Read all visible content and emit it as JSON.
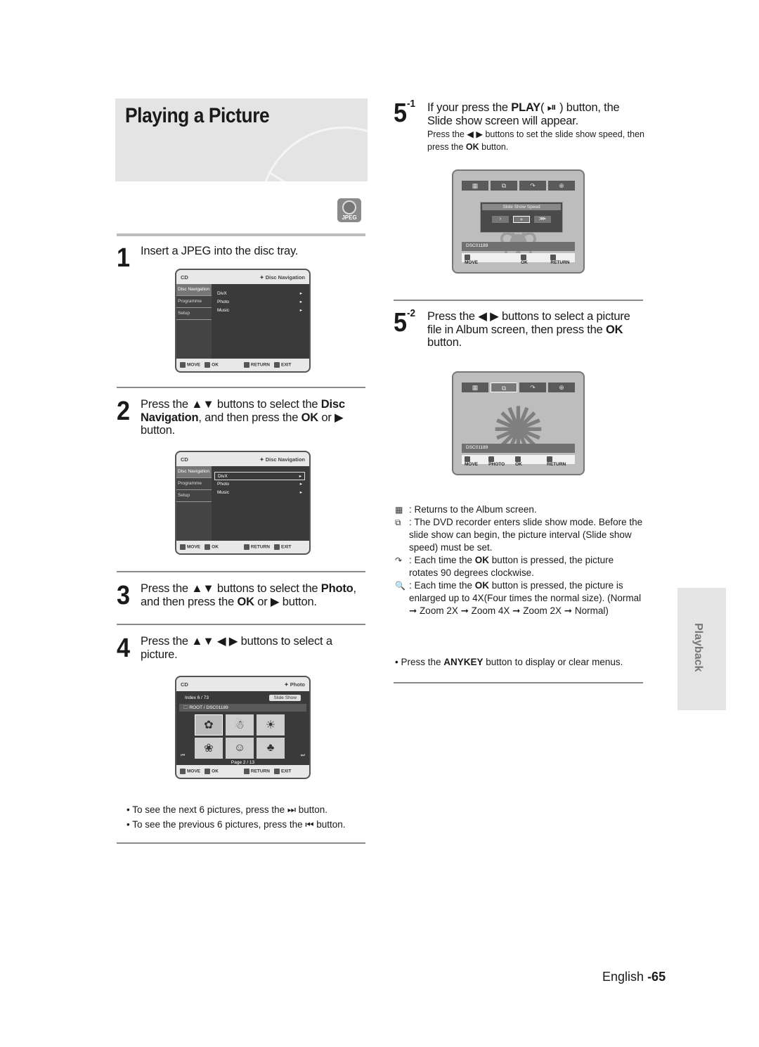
{
  "page": {
    "title": "Playing a Picture",
    "jpeg_badge": "JPEG",
    "side_tab": "Playback",
    "footer_lang": "English",
    "footer_page": "-65"
  },
  "steps": {
    "s1": {
      "num": "1",
      "text": "Insert a JPEG into the disc tray."
    },
    "s2": {
      "num": "2",
      "pre": "Press the ▲▼ buttons to select the ",
      "b1": "Disc Navigation",
      "mid": ", and then press the ",
      "b2": "OK",
      "post": " or ▶ button."
    },
    "s3": {
      "num": "3",
      "pre": "Press the ▲▼ buttons to select the ",
      "b1": "Photo",
      "mid": ", and then press the ",
      "b2": "OK",
      "post": " or ▶ button."
    },
    "s4": {
      "num": "4",
      "text": "Press the ▲▼ ◀ ▶ buttons to select a picture."
    },
    "s51": {
      "num": "5",
      "sup": "-1",
      "pre": "If your press the ",
      "b1": "PLAY",
      "post": "( ⏯ ) button, the Slide show screen will appear.",
      "sub_pre": "Press the ◀ ▶ buttons to set the slide show speed, then press the ",
      "sub_b": "OK",
      "sub_post": " button."
    },
    "s52": {
      "num": "5",
      "sup": "-2",
      "pre": "Press the ◀ ▶ buttons to select a picture file in Album screen, then press the ",
      "b1": "OK",
      "post": " button."
    }
  },
  "osd_menu": {
    "source": "CD",
    "title": "✦ Disc Navigation",
    "side": [
      "Disc Navigation",
      "Programme",
      "Setup"
    ],
    "items": [
      "DivX",
      "Photo",
      "Music"
    ],
    "keys": {
      "move": "MOVE",
      "ok": "OK",
      "return": "RETURN",
      "exit": "EXIT"
    }
  },
  "osd_photo": {
    "source": "CD",
    "title": "✦ Photo",
    "index": "Index  6  /    73",
    "slide_show": "Slide Show",
    "path": "ROOT / DSC01189",
    "page": "Page   2   /    13",
    "thumb_icons": [
      "✿",
      "☃",
      "☀",
      "❀",
      "☺",
      "♣"
    ]
  },
  "osd_slide": {
    "speed_title": "Slide Show Speed",
    "speeds": [
      "›",
      "»",
      "⋙"
    ],
    "filename": "DSC01189",
    "keys": {
      "move": "MOVE",
      "photo": "PHOTO",
      "ok": "OK",
      "return": "RETURN"
    }
  },
  "legend": [
    {
      "icon": "album-icon",
      "glyph": "▦",
      "text": ": Returns to the Album screen."
    },
    {
      "icon": "slideshow-icon",
      "glyph": "⧉",
      "text": ": The DVD recorder enters slide show mode. Before the slide show can begin, the picture interval (Slide show speed) must be set."
    },
    {
      "icon": "rotate-icon",
      "glyph": "↷",
      "pre": ": Each time the ",
      "b": "OK",
      "post": " button is pressed, the picture rotates 90 degrees clockwise."
    },
    {
      "icon": "zoom-icon",
      "glyph": "🔍",
      "pre": ": Each time the ",
      "b": "OK",
      "post": " button is pressed, the picture is enlarged up to 4X(Four times the normal size). (Normal ➞ Zoom 2X ➞ Zoom 4X ➞ Zoom 2X ➞ Normal)"
    }
  ],
  "notes": {
    "anykey_pre": "Press the ",
    "anykey_b": "ANYKEY",
    "anykey_post": " button to display or clear menus.",
    "next": "To see the next 6 pictures, press the ⏭ button.",
    "prev": "To see the previous 6 pictures, press the ⏮ button."
  }
}
